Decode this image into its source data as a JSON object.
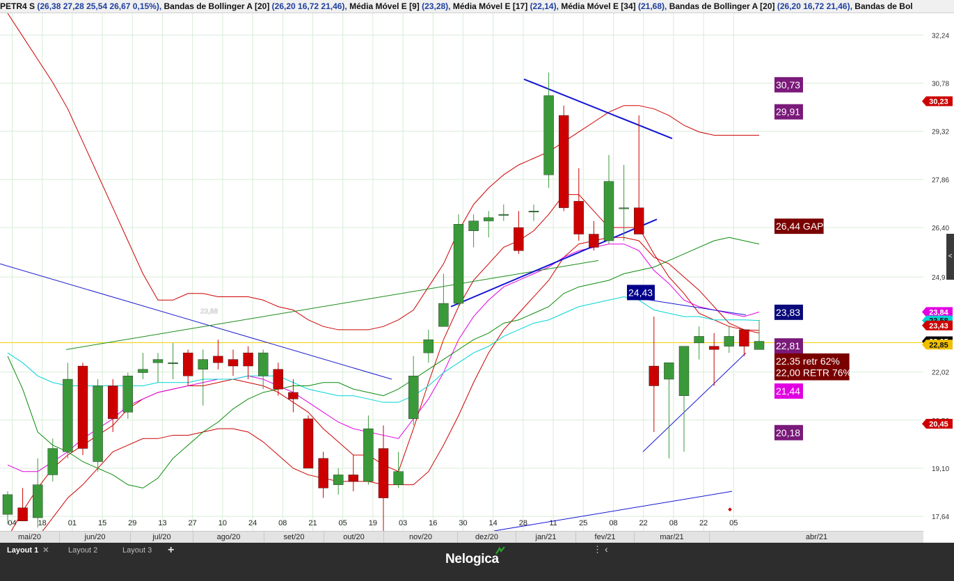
{
  "title_bar": {
    "segments": [
      {
        "label": "PETR4 S",
        "params": "(26,38  27,28  25,54  26,67  0,15%),"
      },
      {
        "label": "Bandas de Bollinger A [20]",
        "params": "(26,20  16,72 21,46),"
      },
      {
        "label": "Média Móvel E [9]",
        "params": "(23,28),"
      },
      {
        "label": "Média Móvel E [17]",
        "params": "(22,14),"
      },
      {
        "label": "Média Móvel E [34]",
        "params": "(21,68),"
      },
      {
        "label": "Bandas de Bollinger A [20]",
        "params": "(26,20  16,72 21,46),"
      },
      {
        "label": "Bandas de Bol",
        "params": ""
      }
    ]
  },
  "chart_data": {
    "type": "candlestick",
    "symbol": "PETR4",
    "y_scale": {
      "min": 17.2,
      "max": 32.9
    },
    "y_ticks": [
      "32,24",
      "30,78",
      "29,32",
      "27,86",
      "26,40",
      "24,9",
      "22,02",
      "20,56",
      "19,10",
      "17,64"
    ],
    "x_ticks": [
      "04",
      "18",
      "01",
      "15",
      "29",
      "13",
      "27",
      "10",
      "24",
      "08",
      "21",
      "05",
      "19",
      "03",
      "16",
      "30",
      "14",
      "28",
      "11",
      "25",
      "08",
      "22",
      "08",
      "22",
      "05"
    ],
    "months": [
      "mai/20",
      "jun/20",
      "jul/20",
      "ago/20",
      "set/20",
      "out/20",
      "nov/20",
      "dez/20",
      "jan/21",
      "fev/21",
      "mar/21",
      "abr/21"
    ],
    "candles": [
      {
        "o": 17.7,
        "h": 18.4,
        "l": 17.4,
        "c": 18.3
      },
      {
        "o": 17.9,
        "h": 18.5,
        "l": 17.5,
        "c": 17.5
      },
      {
        "o": 17.6,
        "h": 19.4,
        "l": 17.3,
        "c": 18.6
      },
      {
        "o": 18.9,
        "h": 20.0,
        "l": 18.7,
        "c": 19.7
      },
      {
        "o": 19.6,
        "h": 22.3,
        "l": 19.4,
        "c": 21.8
      },
      {
        "o": 22.2,
        "h": 22.3,
        "l": 19.5,
        "c": 19.7
      },
      {
        "o": 19.3,
        "h": 21.8,
        "l": 19.0,
        "c": 21.6
      },
      {
        "o": 21.6,
        "h": 21.8,
        "l": 20.2,
        "c": 20.6
      },
      {
        "o": 20.8,
        "h": 22.0,
        "l": 20.6,
        "c": 21.9
      },
      {
        "o": 22.0,
        "h": 22.6,
        "l": 21.8,
        "c": 22.1
      },
      {
        "o": 22.3,
        "h": 22.6,
        "l": 21.7,
        "c": 22.4
      },
      {
        "o": 22.3,
        "h": 22.9,
        "l": 21.8,
        "c": 22.3
      },
      {
        "o": 22.6,
        "h": 22.7,
        "l": 21.6,
        "c": 21.9
      },
      {
        "o": 22.1,
        "h": 22.7,
        "l": 21.0,
        "c": 22.4
      },
      {
        "o": 22.5,
        "h": 23.0,
        "l": 22.1,
        "c": 22.3
      },
      {
        "o": 22.4,
        "h": 22.7,
        "l": 21.9,
        "c": 22.2
      },
      {
        "o": 22.6,
        "h": 22.8,
        "l": 21.8,
        "c": 22.2
      },
      {
        "o": 21.9,
        "h": 22.7,
        "l": 21.5,
        "c": 22.6
      },
      {
        "o": 22.1,
        "h": 22.3,
        "l": 21.3,
        "c": 21.5
      },
      {
        "o": 21.4,
        "h": 21.8,
        "l": 20.8,
        "c": 21.2
      },
      {
        "o": 20.6,
        "h": 20.7,
        "l": 19.1,
        "c": 19.1
      },
      {
        "o": 19.4,
        "h": 19.6,
        "l": 18.2,
        "c": 18.5
      },
      {
        "o": 18.6,
        "h": 19.1,
        "l": 18.3,
        "c": 18.9
      },
      {
        "o": 18.9,
        "h": 19.5,
        "l": 18.4,
        "c": 18.7
      },
      {
        "o": 18.7,
        "h": 20.7,
        "l": 18.6,
        "c": 20.3
      },
      {
        "o": 19.7,
        "h": 20.4,
        "l": 17.2,
        "c": 18.2
      },
      {
        "o": 18.6,
        "h": 19.6,
        "l": 18.5,
        "c": 19.0
      },
      {
        "o": 20.6,
        "h": 22.5,
        "l": 20.4,
        "c": 21.9
      },
      {
        "o": 22.6,
        "h": 23.3,
        "l": 22.3,
        "c": 23.0
      },
      {
        "o": 23.4,
        "h": 25.0,
        "l": 23.4,
        "c": 24.1
      },
      {
        "o": 24.1,
        "h": 26.8,
        "l": 24.0,
        "c": 26.5
      },
      {
        "o": 26.3,
        "h": 26.8,
        "l": 25.8,
        "c": 26.6
      },
      {
        "o": 26.6,
        "h": 26.9,
        "l": 26.1,
        "c": 26.7
      },
      {
        "o": 26.8,
        "h": 27.1,
        "l": 26.6,
        "c": 26.8
      },
      {
        "o": 26.4,
        "h": 26.9,
        "l": 25.6,
        "c": 25.7
      },
      {
        "o": 26.9,
        "h": 27.1,
        "l": 26.6,
        "c": 26.9
      },
      {
        "o": 28.0,
        "h": 31.1,
        "l": 27.6,
        "c": 30.4
      },
      {
        "o": 29.8,
        "h": 30.1,
        "l": 26.9,
        "c": 27.0
      },
      {
        "o": 27.2,
        "h": 28.2,
        "l": 26.0,
        "c": 26.2
      },
      {
        "o": 26.2,
        "h": 26.6,
        "l": 25.7,
        "c": 25.8
      },
      {
        "o": 26.0,
        "h": 28.6,
        "l": 25.9,
        "c": 27.8
      },
      {
        "o": 27.0,
        "h": 28.3,
        "l": 26.0,
        "c": 27.0
      },
      {
        "o": 27.0,
        "h": 29.8,
        "l": 26.3,
        "c": 26.2
      },
      {
        "o": 22.2,
        "h": 23.7,
        "l": 20.2,
        "c": 21.6
      },
      {
        "o": 21.8,
        "h": 21.8,
        "l": 19.4,
        "c": 22.3
      },
      {
        "o": 21.3,
        "h": 22.7,
        "l": 19.6,
        "c": 22.8
      },
      {
        "o": 22.9,
        "h": 23.4,
        "l": 22.4,
        "c": 23.1
      },
      {
        "o": 22.8,
        "h": 23.2,
        "l": 21.6,
        "c": 22.7
      },
      {
        "o": 22.8,
        "h": 23.4,
        "l": 22.6,
        "c": 23.1
      },
      {
        "o": 23.3,
        "h": 23.3,
        "l": 22.5,
        "c": 22.8
      },
      {
        "o": 22.7,
        "h": 23.6,
        "l": 22.9,
        "c": 22.95
      }
    ],
    "series": [
      {
        "color": "#cc0000",
        "values": [
          32.9,
          32.2,
          31.5,
          30.8,
          30.0,
          29.0,
          28.0,
          27.0,
          26.0,
          25.0,
          24.2,
          24.2,
          24.4,
          24.4,
          24.3,
          24.3,
          24.3,
          24.2,
          24.0,
          23.9,
          23.6,
          23.4,
          23.3,
          23.3,
          23.3,
          23.4,
          23.6,
          23.9,
          24.6,
          25.3,
          26.3,
          27.1,
          27.6,
          28.0,
          28.3,
          28.5,
          28.7,
          29.0,
          29.3,
          29.6,
          29.9,
          30.1,
          30.1,
          30.0,
          29.8,
          29.5,
          29.3,
          29.2,
          29.2,
          29.2,
          29.2
        ]
      },
      {
        "color": "#cc0000",
        "values": [
          16.5,
          16.6,
          17.0,
          17.6,
          18.2,
          18.6,
          19.1,
          19.6,
          19.8,
          20.0,
          20.0,
          20.1,
          20.1,
          20.2,
          20.3,
          20.3,
          20.2,
          19.9,
          19.5,
          19.1,
          18.9,
          18.8,
          18.7,
          18.7,
          18.7,
          18.6,
          18.6,
          18.6,
          19.0,
          19.8,
          20.7,
          21.7,
          22.6,
          23.3,
          23.8,
          24.3,
          24.8,
          25.5,
          25.9,
          26.0,
          26.1,
          26.1,
          26.0,
          25.5,
          25.3,
          24.9,
          24.5,
          24.0,
          23.5,
          23.3,
          23.2
        ]
      },
      {
        "color": "#cc0000",
        "values": [
          17.0,
          17.8,
          18.5,
          19.1,
          19.5,
          19.8,
          20.1,
          20.4,
          20.9,
          21.2,
          21.4,
          21.5,
          21.6,
          21.6,
          21.7,
          21.8,
          21.7,
          21.6,
          21.4,
          21.1,
          20.8,
          20.3,
          19.9,
          19.5,
          19.5,
          19.2,
          19.0,
          20.3,
          21.7,
          23.0,
          24.0,
          24.8,
          25.3,
          25.8,
          26.0,
          26.3,
          26.8,
          27.4,
          27.4,
          26.9,
          26.4,
          26.4,
          26.4,
          25.6,
          24.9,
          24.4,
          23.8,
          23.6,
          23.4,
          23.3,
          23.28
        ]
      },
      {
        "color": "#e100e1",
        "values": [
          19.2,
          19.0,
          19.0,
          19.3,
          19.6,
          20.0,
          20.3,
          20.6,
          21.0,
          21.2,
          21.4,
          21.5,
          21.6,
          21.7,
          21.8,
          21.8,
          21.9,
          21.8,
          21.6,
          21.4,
          21.1,
          20.8,
          20.5,
          20.3,
          20.2,
          20.1,
          20.0,
          20.6,
          21.2,
          22.0,
          23.0,
          23.7,
          24.2,
          24.6,
          24.8,
          25.0,
          25.2,
          25.5,
          25.7,
          25.8,
          25.9,
          25.9,
          25.7,
          25.1,
          24.7,
          24.2,
          24.0,
          23.9,
          23.8,
          23.7,
          23.84
        ]
      },
      {
        "color": "#00d4d4",
        "values": [
          22.6,
          22.3,
          21.9,
          21.7,
          21.6,
          21.6,
          21.6,
          21.6,
          21.6,
          21.6,
          21.7,
          21.7,
          21.7,
          21.8,
          21.8,
          21.8,
          21.9,
          21.9,
          21.9,
          21.7,
          21.5,
          21.4,
          21.3,
          21.3,
          21.2,
          21.1,
          21.1,
          21.3,
          21.6,
          22.0,
          22.3,
          22.6,
          22.8,
          23.1,
          23.3,
          23.5,
          23.6,
          23.8,
          24.0,
          24.1,
          24.2,
          24.3,
          24.2,
          23.9,
          23.8,
          23.7,
          23.7,
          23.6,
          23.6,
          23.6,
          23.58
        ]
      },
      {
        "color": "#0a8a0a",
        "values": [
          22.5,
          21.5,
          20.2,
          19.8,
          19.6,
          19.3,
          19.1,
          18.9,
          18.6,
          18.5,
          18.8,
          19.4,
          19.8,
          20.2,
          20.5,
          20.9,
          21.2,
          21.4,
          21.5,
          21.6,
          21.6,
          21.7,
          21.7,
          21.5,
          21.4,
          21.3,
          21.5,
          21.8,
          22.1,
          22.4,
          22.7,
          23.0,
          23.2,
          23.5,
          23.6,
          23.8,
          24.0,
          24.4,
          24.6,
          24.7,
          24.8,
          25.0,
          25.1,
          25.2,
          25.4,
          25.6,
          25.8,
          26.0,
          26.1,
          26.0,
          25.9
        ]
      }
    ],
    "last_price": "22,95",
    "last_price_value": 22.95,
    "axis_tags": [
      {
        "label": "30,23",
        "value": 30.23,
        "color": "#cc0000"
      },
      {
        "label": "23,84",
        "value": 23.84,
        "color": "#e100e1"
      },
      {
        "label": "23,58",
        "value": 23.58,
        "color": "#00d4d4"
      },
      {
        "label": "23,43",
        "value": 23.43,
        "color": "#cc0000"
      },
      {
        "label": "22,95",
        "value": 22.95,
        "color": "#000000"
      },
      {
        "label": "22,85",
        "value": 22.85,
        "color": "#f0c000"
      },
      {
        "label": "20,45",
        "value": 20.45,
        "color": "#cc0000"
      }
    ],
    "annotations": [
      {
        "label": "30,73",
        "value": 30.73,
        "bg": "#7a1a7a"
      },
      {
        "label": "29,91",
        "value": 29.91,
        "bg": "#7a1a7a"
      },
      {
        "label": "26,44 GAP",
        "value": 26.44,
        "bg": "#7a0000"
      },
      {
        "label": "23,83",
        "value": 23.83,
        "bg": "#0a0a7a"
      },
      {
        "label": "22,81",
        "value": 22.81,
        "bg": "#7a1a7a"
      },
      {
        "label": "22,35 retr 62%",
        "value": 22.35,
        "bg": "#7a0000"
      },
      {
        "label": "22,00 RETR 76%",
        "value": 22.0,
        "bg": "#7a0000"
      },
      {
        "label": "21,44",
        "value": 21.44,
        "bg": "#e100e1"
      },
      {
        "label": "20,18",
        "value": 20.18,
        "bg": "#7a1a7a"
      }
    ],
    "chart_labels": [
      {
        "label": "24,43",
        "value": 24.43,
        "bg": "#00008b"
      },
      {
        "label": "23,88",
        "value": 23.88,
        "bg": ""
      }
    ]
  },
  "layout_tabs": [
    "Layout 1",
    "Layout 2",
    "Layout 3"
  ],
  "brand": "Nelogica"
}
